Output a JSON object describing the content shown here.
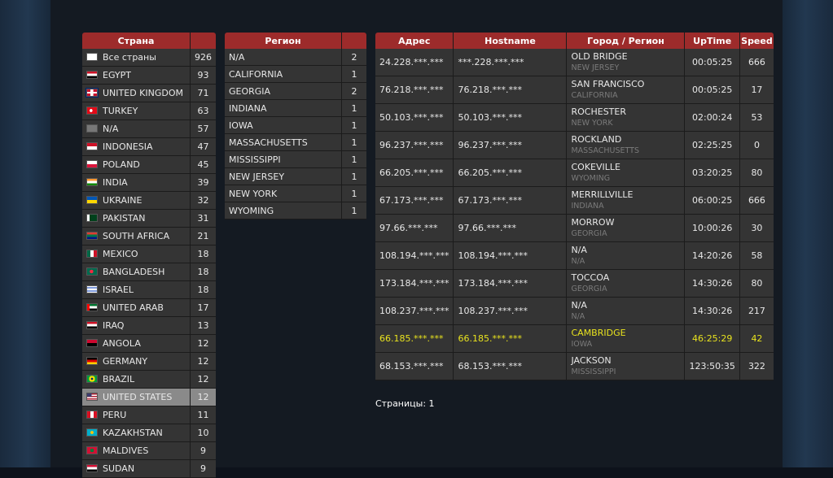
{
  "countries": {
    "headers": [
      "Страна",
      ""
    ],
    "rows": [
      {
        "name": "Все страны",
        "count": "926",
        "flag": "white"
      },
      {
        "name": "EGYPT",
        "count": "93",
        "flag": "eg"
      },
      {
        "name": "UNITED KINGDOM",
        "count": "71",
        "flag": "gb"
      },
      {
        "name": "TURKEY",
        "count": "63",
        "flag": "tr"
      },
      {
        "name": "N/A",
        "count": "57",
        "flag": "na"
      },
      {
        "name": "INDONESIA",
        "count": "47",
        "flag": "id"
      },
      {
        "name": "POLAND",
        "count": "45",
        "flag": "pl"
      },
      {
        "name": "INDIA",
        "count": "39",
        "flag": "in"
      },
      {
        "name": "UKRAINE",
        "count": "32",
        "flag": "ua"
      },
      {
        "name": "PAKISTAN",
        "count": "31",
        "flag": "pk"
      },
      {
        "name": "SOUTH AFRICA",
        "count": "21",
        "flag": "za"
      },
      {
        "name": "MEXICO",
        "count": "18",
        "flag": "mx"
      },
      {
        "name": "BANGLADESH",
        "count": "18",
        "flag": "bd"
      },
      {
        "name": "ISRAEL",
        "count": "18",
        "flag": "il"
      },
      {
        "name": "UNITED ARAB",
        "count": "17",
        "flag": "ae"
      },
      {
        "name": "IRAQ",
        "count": "13",
        "flag": "iq"
      },
      {
        "name": "ANGOLA",
        "count": "12",
        "flag": "ao"
      },
      {
        "name": "GERMANY",
        "count": "12",
        "flag": "de"
      },
      {
        "name": "BRAZIL",
        "count": "12",
        "flag": "br"
      },
      {
        "name": "UNITED STATES",
        "count": "12",
        "flag": "us",
        "selected": true
      },
      {
        "name": "PERU",
        "count": "11",
        "flag": "pe"
      },
      {
        "name": "KAZAKHSTAN",
        "count": "10",
        "flag": "kz"
      },
      {
        "name": "MALDIVES",
        "count": "9",
        "flag": "mv"
      },
      {
        "name": "SUDAN",
        "count": "9",
        "flag": "sd"
      }
    ]
  },
  "regions": {
    "headers": [
      "Регион",
      ""
    ],
    "rows": [
      {
        "name": "N/A",
        "count": "2"
      },
      {
        "name": "CALIFORNIA",
        "count": "1"
      },
      {
        "name": "GEORGIA",
        "count": "2"
      },
      {
        "name": "INDIANA",
        "count": "1"
      },
      {
        "name": "IOWA",
        "count": "1"
      },
      {
        "name": "MASSACHUSETTS",
        "count": "1"
      },
      {
        "name": "MISSISSIPPI",
        "count": "1"
      },
      {
        "name": "NEW JERSEY",
        "count": "1"
      },
      {
        "name": "NEW YORK",
        "count": "1"
      },
      {
        "name": "WYOMING",
        "count": "1"
      }
    ]
  },
  "hosts": {
    "headers": [
      "Адрес",
      "Hostname",
      "Город / Регион",
      "UpTime",
      "Speed"
    ],
    "rows": [
      {
        "address": "24.228.***.***",
        "hostname": "***.228.***.***",
        "city": "OLD BRIDGE",
        "region": "NEW JERSEY",
        "uptime": "00:05:25",
        "speed": "666"
      },
      {
        "address": "76.218.***.***",
        "hostname": "76.218.***.***",
        "city": "SAN FRANCISCO",
        "region": "CALIFORNIA",
        "uptime": "00:05:25",
        "speed": "17"
      },
      {
        "address": "50.103.***.***",
        "hostname": "50.103.***.***",
        "city": "ROCHESTER",
        "region": "NEW YORK",
        "uptime": "02:00:24",
        "speed": "53"
      },
      {
        "address": "96.237.***.***",
        "hostname": "96.237.***.***",
        "city": "ROCKLAND",
        "region": "MASSACHUSETTS",
        "uptime": "02:25:25",
        "speed": "0"
      },
      {
        "address": "66.205.***.***",
        "hostname": "66.205.***.***",
        "city": "COKEVILLE",
        "region": "WYOMING",
        "uptime": "03:20:25",
        "speed": "80"
      },
      {
        "address": "67.173.***.***",
        "hostname": "67.173.***.***",
        "city": "MERRILLVILLE",
        "region": "INDIANA",
        "uptime": "06:00:25",
        "speed": "666"
      },
      {
        "address": "97.66.***.***",
        "hostname": "97.66.***.***",
        "city": "MORROW",
        "region": "GEORGIA",
        "uptime": "10:00:26",
        "speed": "30"
      },
      {
        "address": "108.194.***.***",
        "hostname": "108.194.***.***",
        "city": "N/A",
        "region": "N/A",
        "uptime": "14:20:26",
        "speed": "58"
      },
      {
        "address": "173.184.***.***",
        "hostname": "173.184.***.***",
        "city": "TOCCOA",
        "region": "GEORGIA",
        "uptime": "14:30:26",
        "speed": "80"
      },
      {
        "address": "108.237.***.***",
        "hostname": "108.237.***.***",
        "city": "N/A",
        "region": "N/A",
        "uptime": "14:30:26",
        "speed": "217"
      },
      {
        "address": "66.185.***.***",
        "hostname": "66.185.***.***",
        "city": "CAMBRIDGE",
        "region": "IOWA",
        "uptime": "46:25:29",
        "speed": "42",
        "highlight": true
      },
      {
        "address": "68.153.***.***",
        "hostname": "68.153.***.***",
        "city": "JACKSON",
        "region": "MISSISSIPPI",
        "uptime": "123:50:35",
        "speed": "322"
      }
    ]
  },
  "pagination": {
    "text": "Страницы: 1"
  },
  "colors": {
    "header": "#9d2b2b",
    "row": "#343434",
    "selected": "#8a8a8a",
    "highlight": "#e8e21e",
    "background": "#141a22"
  }
}
